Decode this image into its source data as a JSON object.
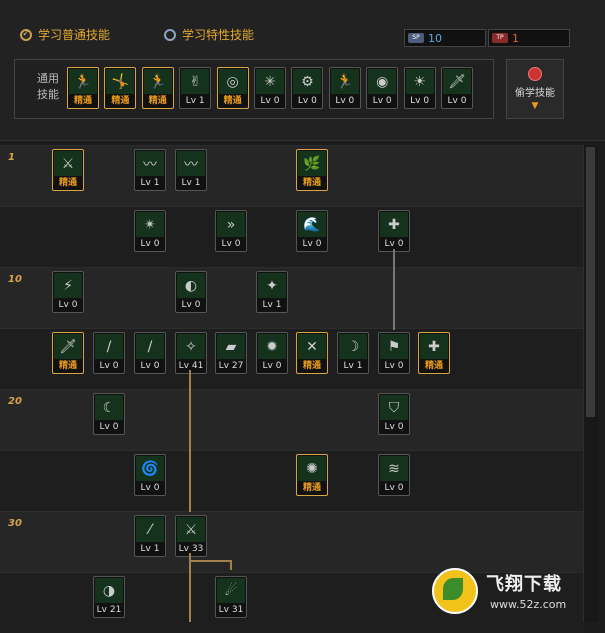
{
  "tabs": {
    "normal": "学习普通技能",
    "trait": "学习特性技能"
  },
  "counters": [
    {
      "tag": "SP",
      "value": "10",
      "tag_color": "#4a5e7c",
      "value_color": "#5aa9e6"
    },
    {
      "tag": "TP",
      "value": "1",
      "tag_color": "#8a2a2a",
      "value_color": "#e4612c"
    }
  ],
  "common": {
    "label": "通用技能",
    "skills": [
      {
        "level": "精通",
        "gold": true,
        "icon": "🏃"
      },
      {
        "level": "精通",
        "gold": true,
        "icon": "🤸"
      },
      {
        "level": "精通",
        "gold": true,
        "icon": "🏃"
      },
      {
        "level": "Lv 1",
        "gold": false,
        "icon": "✌"
      },
      {
        "level": "精通",
        "gold": true,
        "icon": "◎"
      },
      {
        "level": "Lv 0",
        "gold": false,
        "icon": "✳"
      },
      {
        "level": "Lv 0",
        "gold": false,
        "icon": "⚙"
      },
      {
        "level": "Lv 0",
        "gold": false,
        "icon": "🏃"
      },
      {
        "level": "Lv 0",
        "gold": false,
        "icon": "◉"
      },
      {
        "level": "Lv 0",
        "gold": false,
        "icon": "☀"
      },
      {
        "level": "Lv 0",
        "gold": false,
        "icon": "🗡"
      }
    ]
  },
  "steal": {
    "label": "偷学技能"
  },
  "rows": [
    {
      "label": "1",
      "skills": [
        {
          "col": 0,
          "level": "精通",
          "gold": true,
          "icon": "⚔"
        },
        {
          "col": 2,
          "level": "Lv 1",
          "gold": false,
          "icon": "〰"
        },
        {
          "col": 3,
          "level": "Lv 1",
          "gold": false,
          "icon": "〰"
        },
        {
          "col": 6,
          "level": "精通",
          "gold": true,
          "icon": "🌿"
        }
      ]
    },
    {
      "label": "",
      "skills": [
        {
          "col": 2,
          "level": "Lv 0",
          "gold": false,
          "icon": "✴"
        },
        {
          "col": 4,
          "level": "Lv 0",
          "gold": false,
          "icon": "»"
        },
        {
          "col": 6,
          "level": "Lv 0",
          "gold": false,
          "icon": "🌊"
        },
        {
          "col": 8,
          "level": "Lv 0",
          "gold": false,
          "icon": "✚"
        }
      ]
    },
    {
      "label": "10",
      "skills": [
        {
          "col": 0,
          "level": "Lv 0",
          "gold": false,
          "icon": "⚡"
        },
        {
          "col": 3,
          "level": "Lv 0",
          "gold": false,
          "icon": "◐"
        },
        {
          "col": 5,
          "level": "Lv 1",
          "gold": false,
          "icon": "✦"
        }
      ]
    },
    {
      "label": "",
      "skills": [
        {
          "col": 0,
          "level": "精通",
          "gold": true,
          "icon": "🗡"
        },
        {
          "col": 1,
          "level": "Lv 0",
          "gold": false,
          "icon": "/"
        },
        {
          "col": 2,
          "level": "Lv 0",
          "gold": false,
          "icon": "/"
        },
        {
          "col": 3,
          "level": "Lv 41",
          "gold": false,
          "icon": "✧"
        },
        {
          "col": 4,
          "level": "Lv 27",
          "gold": false,
          "icon": "▰"
        },
        {
          "col": 5,
          "level": "Lv 0",
          "gold": false,
          "icon": "✹"
        },
        {
          "col": 6,
          "level": "精通",
          "gold": true,
          "icon": "✕"
        },
        {
          "col": 7,
          "level": "Lv 1",
          "gold": false,
          "icon": "☽"
        },
        {
          "col": 8,
          "level": "Lv 0",
          "gold": false,
          "icon": "⚑"
        },
        {
          "col": 9,
          "level": "精通",
          "gold": true,
          "icon": "✚"
        }
      ]
    },
    {
      "label": "20",
      "skills": [
        {
          "col": 1,
          "level": "Lv 0",
          "gold": false,
          "icon": "☾"
        },
        {
          "col": 8,
          "level": "Lv 0",
          "gold": false,
          "icon": "⛉"
        }
      ]
    },
    {
      "label": "",
      "skills": [
        {
          "col": 2,
          "level": "Lv 0",
          "gold": false,
          "icon": "🌀"
        },
        {
          "col": 6,
          "level": "精通",
          "gold": true,
          "icon": "✺"
        },
        {
          "col": 8,
          "level": "Lv 0",
          "gold": false,
          "icon": "≋"
        }
      ]
    },
    {
      "label": "30",
      "skills": [
        {
          "col": 2,
          "level": "Lv 1",
          "gold": false,
          "icon": "⁄"
        },
        {
          "col": 3,
          "level": "Lv 33",
          "gold": false,
          "icon": "⚔"
        }
      ]
    },
    {
      "label": "",
      "skills": [
        {
          "col": 1,
          "level": "Lv 21",
          "gold": false,
          "icon": "◑"
        },
        {
          "col": 4,
          "level": "Lv 31",
          "gold": false,
          "icon": "☄"
        }
      ]
    }
  ],
  "watermark": {
    "title": "飞翔下载",
    "url": "www.52z.com"
  }
}
